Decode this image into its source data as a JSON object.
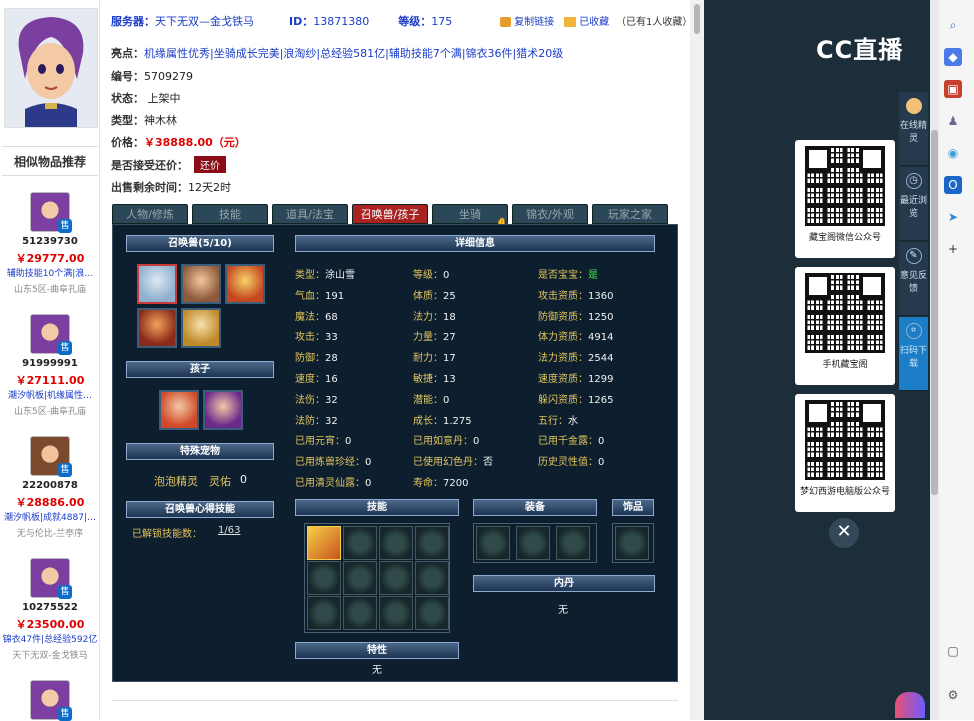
{
  "header": {
    "server_label": "服务器：",
    "server_value": "天下无双—金戈铁马",
    "id_label": "ID：",
    "id_value": "13871380",
    "level_label": "等级：",
    "level_value": "175",
    "copy_link": "复制链接",
    "favorited": "已收藏",
    "fav_count": "（已有1人收藏）"
  },
  "info": {
    "highlights_label": "亮点：",
    "highlights_value": "机缘属性优秀|坐骑成长完美|浪淘纱|总经验581亿|辅助技能7个满|锦衣36件|猎术20级",
    "serial_label": "编号：",
    "serial_value": "5709279",
    "status_label": "状态：",
    "status_value": "上架中",
    "type_label": "类型：",
    "type_value": "神木林",
    "price_label": "价格：",
    "price_value": "￥38888.00（元）",
    "bargain_label": "是否接受还价：",
    "bargain_button": "还价",
    "remaining_label": "出售剩余时间：",
    "remaining_value": "12天2时"
  },
  "left": {
    "similar_title": "相似物品推荐",
    "sale_badge": "售",
    "items": [
      {
        "id": "51239730",
        "price": "￥29777.00",
        "desc": "辅助技能10个满|浪…",
        "server": "山东5区-曲阜孔庙"
      },
      {
        "id": "91999991",
        "price": "￥27111.00",
        "desc": "潮汐帆板|机缘属性…",
        "server": "山东5区-曲阜孔庙"
      },
      {
        "id": "22200878",
        "price": "￥28886.00",
        "desc": "潮汐帆板|成就4887|…",
        "server": "无与伦比-兰亭序"
      },
      {
        "id": "10275522",
        "price": "￥23500.00",
        "desc": "锦衣47件|总经验592亿",
        "server": "天下无双-金戈铁马"
      },
      {
        "id": "",
        "price": "",
        "desc": "",
        "server": ""
      }
    ]
  },
  "tabs": [
    "人物/修炼",
    "技能",
    "道具/法宝",
    "召唤兽/孩子",
    "坐骑",
    "锦衣/外观",
    "玩家之家"
  ],
  "pet": {
    "summon_header": "召唤兽(5/10)",
    "detail_header": "详细信息",
    "child_header": "孩子",
    "special_header": "特殊宠物",
    "special_name": "泡泡精灵",
    "special_soul_label": "灵佑",
    "special_soul_value": "0",
    "mind_header": "召唤兽心得技能",
    "unlock_label": "已解锁技能数：",
    "unlock_value": "1/63",
    "skills_header": "技能",
    "equip_header": "装备",
    "ornament_header": "饰品",
    "neidan_header": "内丹",
    "neidan_value": "无",
    "trait_header": "特性",
    "trait_value": "无",
    "stats": [
      {
        "label": "类型：",
        "value": "涂山雪"
      },
      {
        "label": "等级：",
        "value": "0"
      },
      {
        "label": "是否宝宝：",
        "value": "是"
      },
      {
        "label": "气血：",
        "value": "191"
      },
      {
        "label": "体质：",
        "value": "25"
      },
      {
        "label": "攻击资质：",
        "value": "1360"
      },
      {
        "label": "魔法：",
        "value": "68"
      },
      {
        "label": "法力：",
        "value": "18"
      },
      {
        "label": "防御资质：",
        "value": "1250"
      },
      {
        "label": "攻击：",
        "value": "33"
      },
      {
        "label": "力量：",
        "value": "27"
      },
      {
        "label": "体力资质：",
        "value": "4914"
      },
      {
        "label": "防御：",
        "value": "28"
      },
      {
        "label": "耐力：",
        "value": "17"
      },
      {
        "label": "法力资质：",
        "value": "2544"
      },
      {
        "label": "速度：",
        "value": "16"
      },
      {
        "label": "敏捷：",
        "value": "13"
      },
      {
        "label": "速度资质：",
        "value": "1299"
      },
      {
        "label": "法伤：",
        "value": "32"
      },
      {
        "label": "潜能：",
        "value": "0"
      },
      {
        "label": "躲闪资质：",
        "value": "1265"
      },
      {
        "label": "法防：",
        "value": "32"
      },
      {
        "label": "成长：",
        "value": "1.275"
      },
      {
        "label": "五行：",
        "value": "水"
      },
      {
        "label": "已用元宵：",
        "value": "0"
      },
      {
        "label": "已用如意丹：",
        "value": "0"
      },
      {
        "label": "已用千金露：",
        "value": "0"
      },
      {
        "label": "已用炼兽珍经：",
        "value": "0"
      },
      {
        "label": "已使用幻色丹：",
        "value": "否"
      },
      {
        "label": "历史灵性值：",
        "value": "0"
      },
      {
        "label": "已用清灵仙露：",
        "value": "0"
      },
      {
        "label": "寿命：",
        "value": "7200"
      }
    ]
  },
  "cc": {
    "logo": "CC直播",
    "side": [
      {
        "label": "在线精灵"
      },
      {
        "label": "最近浏览"
      },
      {
        "label": "意见反馈"
      },
      {
        "label": "扫码下载"
      }
    ],
    "qr_labels": [
      "藏宝阁微信公众号",
      "手机藏宝阁",
      "梦幻西游电脑版公众号"
    ],
    "close": "✕"
  },
  "colors": {
    "accent_red": "#e00000",
    "link_blue": "#1a3cc9",
    "panel_bg": "#0d1f2f",
    "tab_active": "#a72221"
  }
}
